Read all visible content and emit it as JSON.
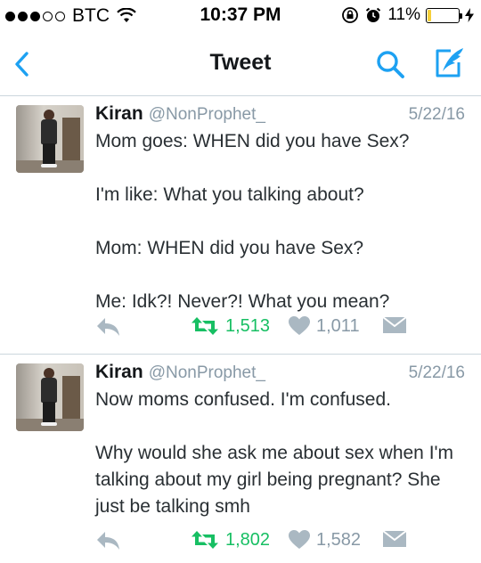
{
  "status_bar": {
    "carrier": "BTC",
    "time": "10:37 PM",
    "battery_percent": "11%",
    "battery_level": 0.11,
    "signal_filled": 3,
    "signal_total": 5,
    "icons": [
      "signal-dots-icon",
      "wifi-icon",
      "rotation-lock-icon",
      "alarm-icon",
      "battery-icon",
      "charging-bolt-icon"
    ]
  },
  "nav": {
    "title": "Tweet",
    "icons": [
      "back-chevron-icon",
      "search-icon",
      "compose-icon"
    ]
  },
  "colors": {
    "accent": "#1da1f2",
    "retweet": "#17bf63",
    "muted": "#8899a6",
    "text": "#292f33",
    "battery_fill": "#f5cf3a"
  },
  "tweets": [
    {
      "name": "Kiran",
      "handle": "@NonProphet_",
      "date": "5/22/16",
      "text": "Mom goes: WHEN did you have Sex?\n\nI'm like: What you talking about?\n\nMom: WHEN did you have Sex?\n\nMe: Idk?! Never?! What you mean?",
      "retweets": "1,513",
      "likes": "1,011"
    },
    {
      "name": "Kiran",
      "handle": "@NonProphet_",
      "date": "5/22/16",
      "text": "Now moms confused. I'm confused.\n\nWhy would she ask me about sex when I'm talking about my girl being pregnant? She just be talking smh",
      "retweets": "1,802",
      "likes": "1,582"
    }
  ]
}
